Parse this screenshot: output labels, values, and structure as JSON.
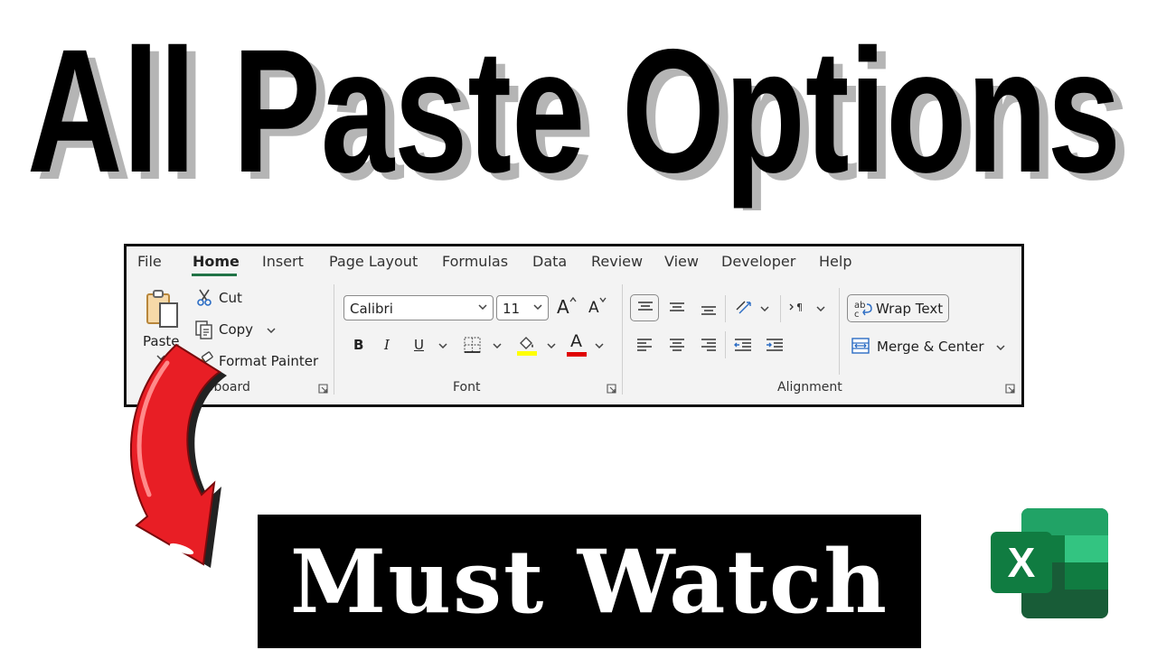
{
  "title": {
    "text": "All Paste Options"
  },
  "ribbon": {
    "tabs": [
      {
        "label": "File"
      },
      {
        "label": "Home",
        "active": true
      },
      {
        "label": "Insert"
      },
      {
        "label": "Page Layout"
      },
      {
        "label": "Formulas"
      },
      {
        "label": "Data"
      },
      {
        "label": "Review"
      },
      {
        "label": "View"
      },
      {
        "label": "Developer"
      },
      {
        "label": "Help"
      }
    ],
    "clipboard": {
      "group_label": "Clipboard",
      "paste": "Paste",
      "cut": "Cut",
      "copy": "Copy",
      "format_painter": "Format Painter"
    },
    "font": {
      "group_label": "Font",
      "font_name": "Calibri",
      "font_size": "11",
      "bold": "B",
      "italic": "I",
      "underline": "U",
      "font_color_letter": "A",
      "grow": "A",
      "shrink": "A"
    },
    "alignment": {
      "group_label": "Alignment",
      "wrap_text": "Wrap Text",
      "merge_center": "Merge & Center"
    }
  },
  "banner": {
    "text": "Must Watch"
  },
  "excel_logo": {
    "letter": "X"
  },
  "colors": {
    "accent": "#217346",
    "highlight": "#ffff00",
    "font_color": "#e00000",
    "arrow": "#e81e25"
  },
  "icons": [
    "clipboard-icon",
    "scissors-icon",
    "copy-icon",
    "format-painter-icon",
    "border-icon",
    "fill-color-icon",
    "align-icon",
    "orientation-icon",
    "indent-icon",
    "wrap-icon",
    "merge-icon",
    "excel-icon",
    "curved-arrow-icon"
  ]
}
